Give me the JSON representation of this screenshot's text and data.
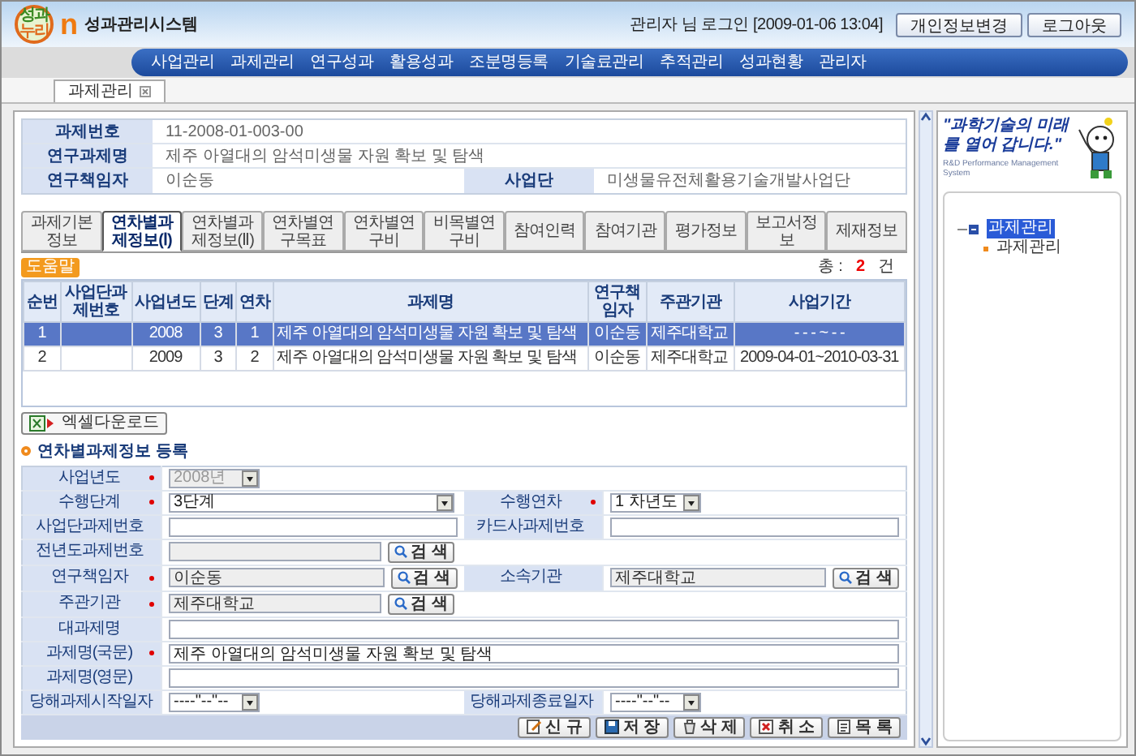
{
  "header": {
    "logo_mark": [
      "성과",
      "누리"
    ],
    "logo_letter": "n",
    "system_name": "성과관리시스템",
    "login_info": "관리자 님 로그인 [2009-01-06 13:04]",
    "buttons": [
      "개인정보변경",
      "로그아웃"
    ]
  },
  "nav": [
    "사업관리",
    "과제관리",
    "연구성과",
    "활용성과",
    "조분명등록",
    "기술료관리",
    "추적관리",
    "성과현황",
    "관리자"
  ],
  "page_tabs": [
    {
      "label": "과제관리",
      "selected": true
    }
  ],
  "summary": [
    [
      {
        "label": "과제번호",
        "value": "11-2008-01-003-00"
      }
    ],
    [
      {
        "label": "연구과제명",
        "value": "제주 아열대의 암석미생물 자원 확보 및 탐색"
      }
    ],
    [
      {
        "label": "연구책임자",
        "value": "이순동"
      },
      {
        "label": "사업단",
        "value": "미생물유전체활용기술개발사업단"
      }
    ]
  ],
  "detail_tabs": [
    {
      "label": "과제기본정보",
      "selected": false
    },
    {
      "label": "연차별과제정보(Ⅰ)",
      "selected": true
    },
    {
      "label": "연차별과제정보(Ⅱ)",
      "selected": false
    },
    {
      "label": "연차별연구목표",
      "selected": false
    },
    {
      "label": "연차별연구비",
      "selected": false
    },
    {
      "label": "비목별연구비",
      "selected": false
    },
    {
      "label": "참여인력",
      "selected": false
    },
    {
      "label": "참여기관",
      "selected": false
    },
    {
      "label": "평가정보",
      "selected": false
    },
    {
      "label": "보고서정보",
      "selected": false
    },
    {
      "label": "제재정보",
      "selected": false
    }
  ],
  "help_badge": "도움말",
  "total": {
    "label": "총 :",
    "count": "2",
    "unit": "건"
  },
  "table": {
    "columns": [
      "순번",
      "사업단과제번호",
      "사업년도",
      "단계",
      "연차",
      "과제명",
      "연구책임자",
      "주관기관",
      "사업기간"
    ],
    "rows": [
      {
        "selected": true,
        "cells": [
          "1",
          "",
          "2008",
          "3",
          "1",
          "제주 아열대의 암석미생물 자원 확보 및 탐색",
          "이순동",
          "제주대학교",
          "- - -  ~  - -"
        ]
      },
      {
        "selected": false,
        "cells": [
          "2",
          "",
          "2009",
          "3",
          "2",
          "제주 아열대의 암석미생물 자원 확보 및 탐색",
          "이순동",
          "제주대학교",
          "2009-04-01~2010-03-31"
        ]
      }
    ]
  },
  "excel_button": "엑셀다운로드",
  "form": {
    "title": "연차별과제정보 등록",
    "rows": [
      [
        {
          "label": "사업년도",
          "required": true,
          "kind": "select",
          "value": "2008년",
          "disabled": true
        }
      ],
      [
        {
          "label": "수행단계",
          "required": true,
          "kind": "select",
          "value": "3단계",
          "disabled": false
        },
        {
          "label": "수행연차",
          "required": true,
          "kind": "select",
          "value": "1 차년도",
          "disabled": false
        }
      ],
      [
        {
          "label": "사업단과제번호",
          "required": false,
          "kind": "text",
          "disabled": false
        },
        {
          "label": "카드사과제번호",
          "required": false,
          "kind": "text",
          "disabled": false
        }
      ],
      [
        {
          "label": "전년도과제번호",
          "required": false,
          "kind": "search",
          "disabled": true,
          "button": "검 색"
        }
      ],
      [
        {
          "label": "연구책임자",
          "required": true,
          "kind": "search",
          "value": "이순동",
          "disabled": true,
          "button": "검 색"
        },
        {
          "label": "소속기관",
          "required": false,
          "kind": "search",
          "value": "제주대학교",
          "disabled": true,
          "button": "검 색"
        }
      ],
      [
        {
          "label": "주관기관",
          "required": true,
          "kind": "search",
          "value": "제주대학교",
          "disabled": true,
          "button": "검 색"
        }
      ],
      [
        {
          "label": "대과제명",
          "required": false,
          "kind": "text",
          "disabled": false
        }
      ],
      [
        {
          "label": "과제명(국문)",
          "required": true,
          "kind": "text",
          "value": "제주 아열대의 암석미생물 자원 확보 및 탐색",
          "disabled": false
        }
      ],
      [
        {
          "label": "과제명(영문)",
          "required": false,
          "kind": "text",
          "disabled": false
        }
      ],
      [
        {
          "label": "당해과제시작일자",
          "required": false,
          "kind": "date",
          "value": "----\"--\"--",
          "disabled": false
        },
        {
          "label": "당해과제종료일자",
          "required": false,
          "kind": "date",
          "value": "----\"--\"--",
          "disabled": false
        }
      ]
    ]
  },
  "buttons": [
    {
      "label": "신 규",
      "kind": "new"
    },
    {
      "label": "저 장",
      "kind": "save"
    },
    {
      "label": "삭 제",
      "kind": "delete"
    },
    {
      "label": "취 소",
      "kind": "cancel"
    },
    {
      "label": "목 록",
      "kind": "list"
    }
  ],
  "sidebar": {
    "slogan": [
      "\"과학기술의 미래를",
      "열어 갑니다.\""
    ],
    "subtitle": "R&D Performance Management System",
    "tree": [
      {
        "label": "과제관리",
        "selected": true,
        "expanded": true,
        "children": [
          {
            "label": "과제관리",
            "selected": false
          }
        ]
      }
    ]
  }
}
